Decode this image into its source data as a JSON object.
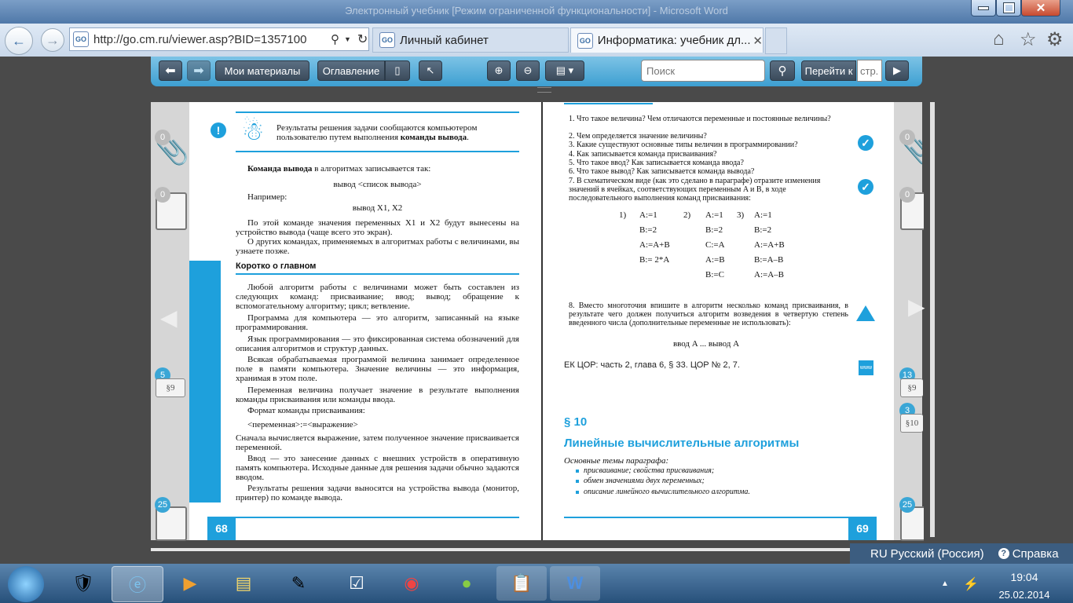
{
  "window": {
    "title": "Электронный учебник [Режим ограниченной функциональности] - Microsoft Word"
  },
  "browser": {
    "address": "http://go.cm.ru/viewer.asp?BID=1357100",
    "tabs": [
      {
        "label": "Личный кабинет",
        "favicon": "GO"
      },
      {
        "label": "Информатика: учебник дл...",
        "favicon": "GO"
      }
    ],
    "close_tab_glyph": "✕"
  },
  "toolbar": {
    "my_materials": "Мои материалы",
    "contents": "Оглавление",
    "search_placeholder": "Поиск",
    "goto_label": "Перейти к",
    "page_placeholder": "стр."
  },
  "left_page": {
    "page_number": "68",
    "note": "Результаты решения задачи сообщаются компьютером пользователю путем выполнения",
    "note_bold": "команды вывода",
    "p1a": "Команда вывода",
    "p1b": " в алгоритмах записывается так:",
    "code1": "вывод <список вывода>",
    "example": "Например:",
    "code2": "вывод X1, X2",
    "p2": "По этой команде значения переменных X1 и X2 будут вынесены на устройство вывода (чаще всего это экран).",
    "p3": "О других командах, применяемых в алгоритмах работы с величинами, вы узнаете позже.",
    "summary_title": "Коротко о главном",
    "s1": "Любой алгоритм работы с величинами может быть составлен из следующих команд: присваивание; ввод; вывод; обращение к вспомогательному алгоритму; цикл; ветвление.",
    "s2": "Программа для компьютера — это алгоритм, записанный на языке программирования.",
    "s3": "Язык программирования — это фиксированная система обозначений для описания алгоритмов и структур данных.",
    "s4": "Всякая обрабатываемая программой величина занимает определенное поле в памяти компьютера. Значение величины — это информация, хранимая в этом поле.",
    "s5": "Переменная величина получает значение в результате выполнения команды присваивания или команды ввода.",
    "s6": "Формат команды присваивания:",
    "s7": "<переменная>:=<выражение>",
    "s8": "Сначала вычисляется выражение, затем полученное значение присваивается переменной.",
    "s9": "Ввод — это занесение данных с внешних устройств в оперативную память компьютера. Исходные данные для решения задачи обычно задаются вводом.",
    "s10": "Результаты решения задачи выносятся на устройства вывода (монитор, принтер) по команде вывода."
  },
  "right_page": {
    "page_number": "69",
    "questions": [
      "1. Что такое величина? Чем отличаются переменные и постоянные величины?",
      "2. Чем определяется значение величины?",
      "3. Какие существуют основные типы величин в программировании?",
      "4. Как записывается команда присваивания?",
      "5. Что такое ввод? Как записывается команда ввода?",
      "6. Что такое вывод? Как записывается команда вывода?",
      "7. В схематическом виде (как это сделано в параграфе) отразите изменения значений в ячейках, соответствующих переменным A и B, в ходе последовательного выполнения команд присваивания:"
    ],
    "col1": [
      "1)",
      "A:=1",
      "B:=2",
      "A:=A+B",
      "B:= 2*A"
    ],
    "col2": [
      "2)",
      "A:=1",
      "B:=2",
      "C:=A",
      "A:=B",
      "B:=C"
    ],
    "col3": [
      "3)",
      "A:=1",
      "B:=2",
      "A:=A+B",
      "B:=A–B",
      "A:=A–B"
    ],
    "q8": "8. Вместо многоточия впишите в алгоритм несколько команд присваивания, в результате чего должен получиться алгоритм возведения в четвертую степень введенного числа (дополнительные переменные не использовать):",
    "q8_code": "ввод A ... вывод A",
    "ek": "ЕК ЦОР: часть 2, глава 6, § 33. ЦОР № 2, 7.",
    "section_num": "§ 10",
    "section_title": "Линейные вычислительные алгоритмы",
    "topics_title": "Основные темы параграфа:",
    "topics": [
      "присваивание; свойства присваивания;",
      "обмен значениями двух переменных;",
      "описание линейного вычислительного алгоритма."
    ],
    "www": "www"
  },
  "side_left": {
    "b1": "0",
    "b2": "0",
    "b3": "5",
    "tag3": "§9",
    "b4": "25"
  },
  "side_right": {
    "b1": "0",
    "b2": "0",
    "b3": "13",
    "tag3": "§9",
    "b4": "3",
    "tag4": "§10",
    "b5": "25"
  },
  "taskbar": {
    "lang": "RU",
    "lang_name": "Русский (Россия)",
    "help": "Справка",
    "time": "19:04",
    "date": "25.02.2014"
  }
}
